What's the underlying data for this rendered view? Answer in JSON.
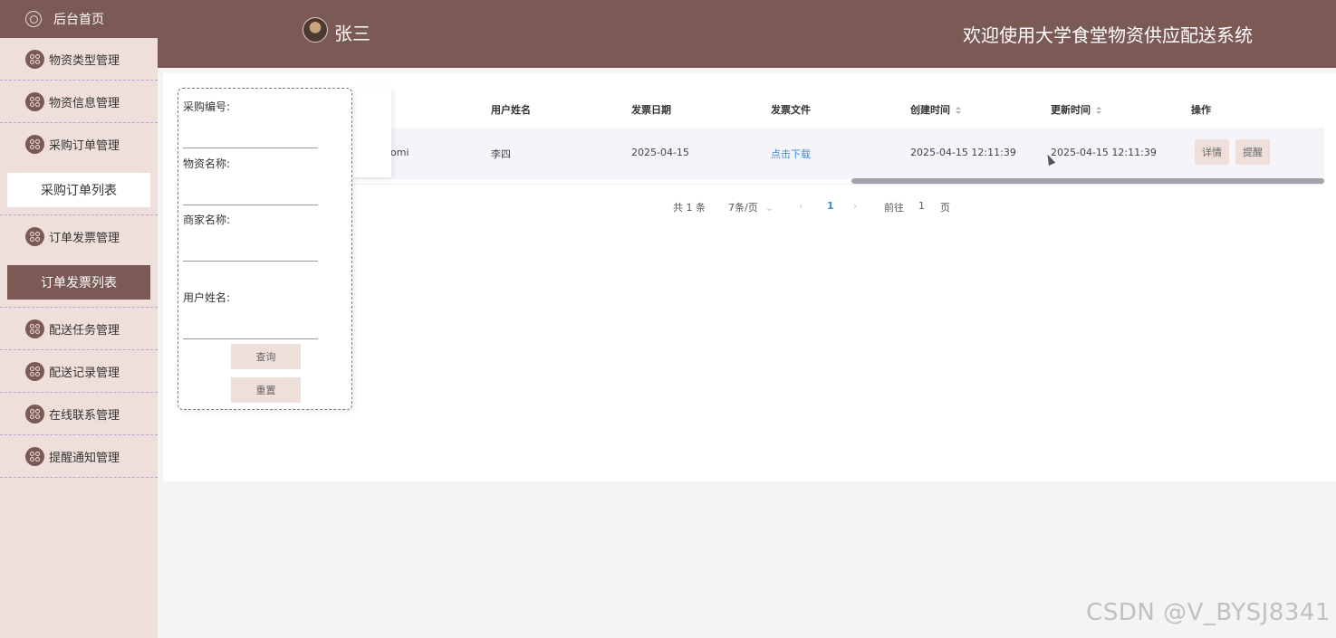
{
  "sidebar": {
    "home": "后台首页",
    "menu": [
      {
        "label": "物资类型管理"
      },
      {
        "label": "物资信息管理"
      },
      {
        "label": "采购订单管理"
      },
      {
        "label": "订单发票管理"
      },
      {
        "label": "配送任务管理"
      },
      {
        "label": "配送记录管理"
      },
      {
        "label": "在线联系管理"
      },
      {
        "label": "提醒通知管理"
      }
    ],
    "sub_purchase": "采购订单列表",
    "sub_invoice": "订单发票列表"
  },
  "header": {
    "user_name": "张三",
    "title": "欢迎使用大学食堂物资供应配送系统"
  },
  "search": {
    "fields": [
      {
        "label": "采购编号:"
      },
      {
        "label": "物资名称:"
      },
      {
        "label": "商家名称:"
      },
      {
        "label": "用户姓名:"
      }
    ],
    "query_btn": "查询",
    "reset_btn": "重置"
  },
  "table": {
    "columns": [
      "用户姓名",
      "发票日期",
      "发票文件",
      "创建时间",
      "更新时间",
      "操作"
    ],
    "rows": [
      {
        "partial": "omi",
        "user_name": "李四",
        "invoice_date": "2025-04-15",
        "invoice_file": "点击下载",
        "created": "2025-04-15 12:11:39",
        "updated": "2025-04-15 12:11:39",
        "actions": [
          "详情",
          "提醒"
        ]
      }
    ]
  },
  "pagination": {
    "total": "共 1 条",
    "page_size": "7条/页",
    "current": "1",
    "goto_prefix": "前往",
    "goto_value": "1",
    "goto_suffix": "页"
  },
  "watermark": "CSDN @V_BYSJ8341",
  "colors": {
    "brand": "#7b5a55",
    "sidebar_bg": "#efdfda",
    "link": "#3a8ee6"
  }
}
